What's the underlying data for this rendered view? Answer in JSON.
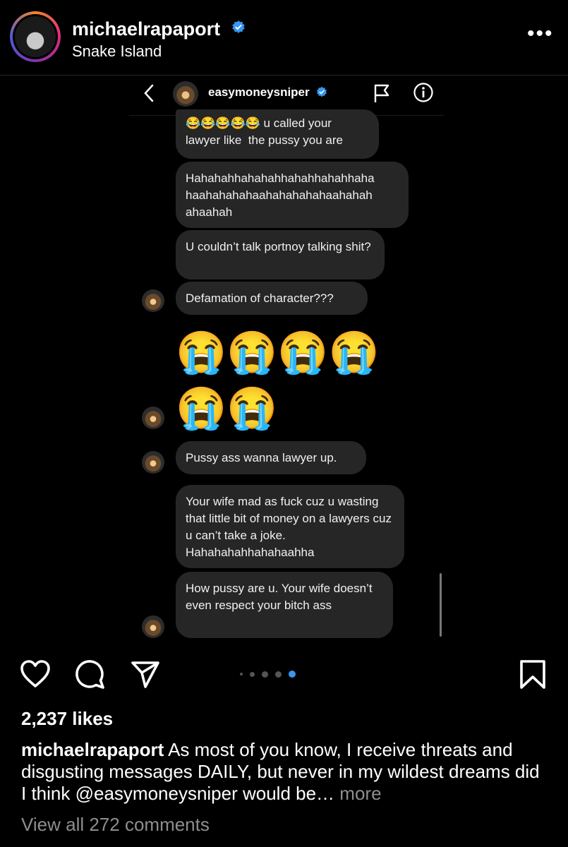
{
  "post": {
    "username": "michaelrapaport",
    "location": "Snake Island",
    "more_label": "•••"
  },
  "dm": {
    "contact_name": "easymoneysniper",
    "messages": [
      {
        "text": "😂😂😂😂😂 u called your lawyer like  the pussy you are"
      },
      {
        "text": "Hahahahhahahahhahahhahahhaha haahahahahaahahahahahaahahah ahaahah"
      },
      {
        "text": "U couldn’t talk portnoy talking shit?"
      },
      {
        "text": "Defamation of character???"
      },
      {
        "text": "Pussy ass wanna lawyer up."
      },
      {
        "text": "Your wife mad as fuck cuz u wasting that little bit of money on a lawyers cuz u can’t take a joke. Hahahahahhahahaahha"
      },
      {
        "text": "How pussy are u. Your wife doesn’t even respect your bitch ass"
      }
    ],
    "emoji_row_1": "😭😭😭😭",
    "emoji_row_2": "😭😭"
  },
  "actions": {
    "icons": [
      "heart-icon",
      "comment-icon",
      "share-icon",
      "save-icon"
    ],
    "carousel_total": 5,
    "carousel_active": 5
  },
  "likes": "2,237 likes",
  "caption": {
    "username": "michaelrapaport",
    "text": " As most of you know, I receive threats and disgusting messages DAILY, but never in my wildest dreams did I think @easymoneysniper would be…",
    "more": " more"
  },
  "view_comments": "View all 272 comments",
  "colors": {
    "background": "#000000",
    "bubble": "#262626",
    "verified": "#3897f0",
    "muted": "#8e8e8e",
    "active_dot": "#3897f0"
  }
}
